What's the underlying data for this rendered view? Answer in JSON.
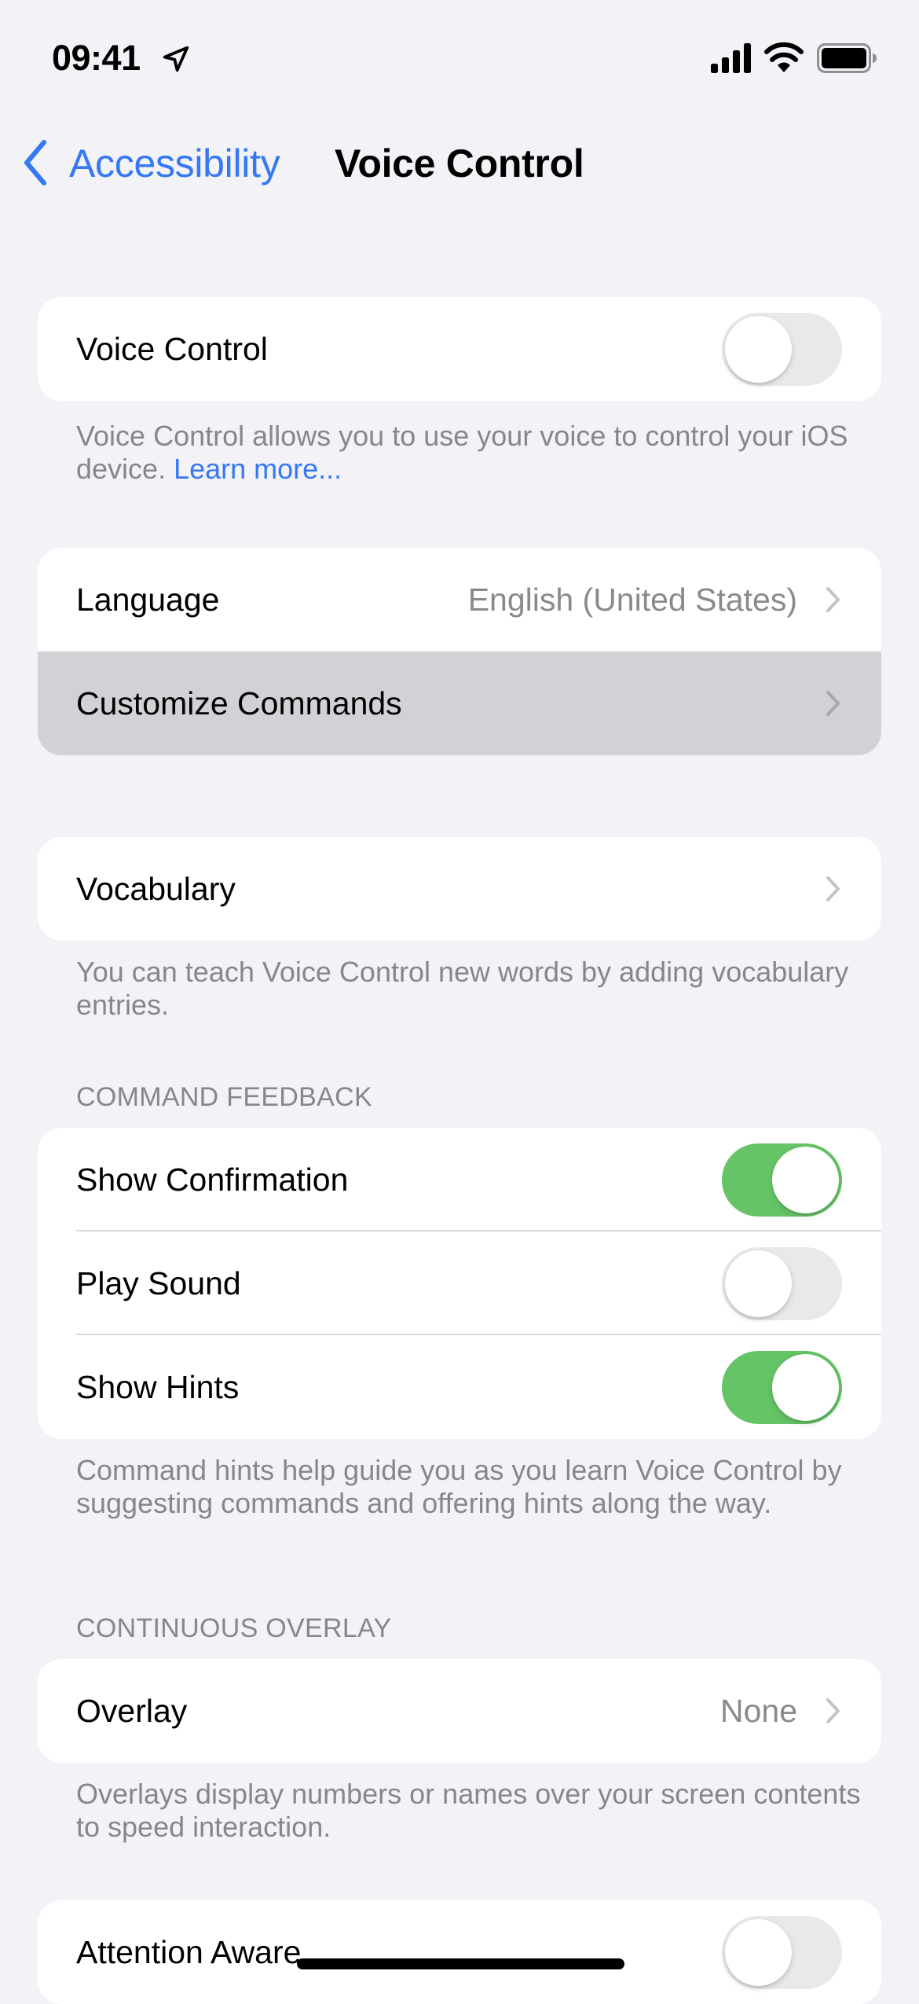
{
  "status_bar": {
    "time": "09:41",
    "icons": [
      "location-arrow-icon",
      "cellular-signal-icon",
      "wifi-icon",
      "battery-icon"
    ]
  },
  "nav": {
    "back_label": "Accessibility",
    "title": "Voice Control"
  },
  "colors": {
    "background": "#F2F2F7",
    "card": "#FFFFFF",
    "accent_blue": "#3478F6",
    "toggle_on": "#65C466",
    "toggle_off": "#E9E9EB",
    "secondary_text": "#86868B",
    "highlight_row": "#D1D1D6"
  },
  "sections": {
    "voice_control": {
      "toggle_label": "Voice Control",
      "toggle_on": false,
      "footer_text": "Voice Control allows you to use your voice to control your iOS device. ",
      "footer_link": "Learn more..."
    },
    "language_group": {
      "language_label": "Language",
      "language_value": "English (United States)",
      "customize_label": "Customize Commands"
    },
    "vocabulary": {
      "label": "Vocabulary",
      "footer_text": "You can teach Voice Control new words by adding vocabulary entries."
    },
    "command_feedback": {
      "header": "COMMAND FEEDBACK",
      "items": [
        {
          "label": "Show Confirmation",
          "on": true
        },
        {
          "label": "Play Sound",
          "on": false
        },
        {
          "label": "Show Hints",
          "on": true
        }
      ],
      "footer_text": "Command hints help guide you as you learn Voice Control by suggesting commands and offering hints along the way."
    },
    "continuous_overlay": {
      "header": "CONTINUOUS OVERLAY",
      "overlay_label": "Overlay",
      "overlay_value": "None",
      "footer_text": "Overlays display numbers or names over your screen contents to speed interaction."
    },
    "attention": {
      "label": "Attention Aware",
      "on": false
    }
  }
}
